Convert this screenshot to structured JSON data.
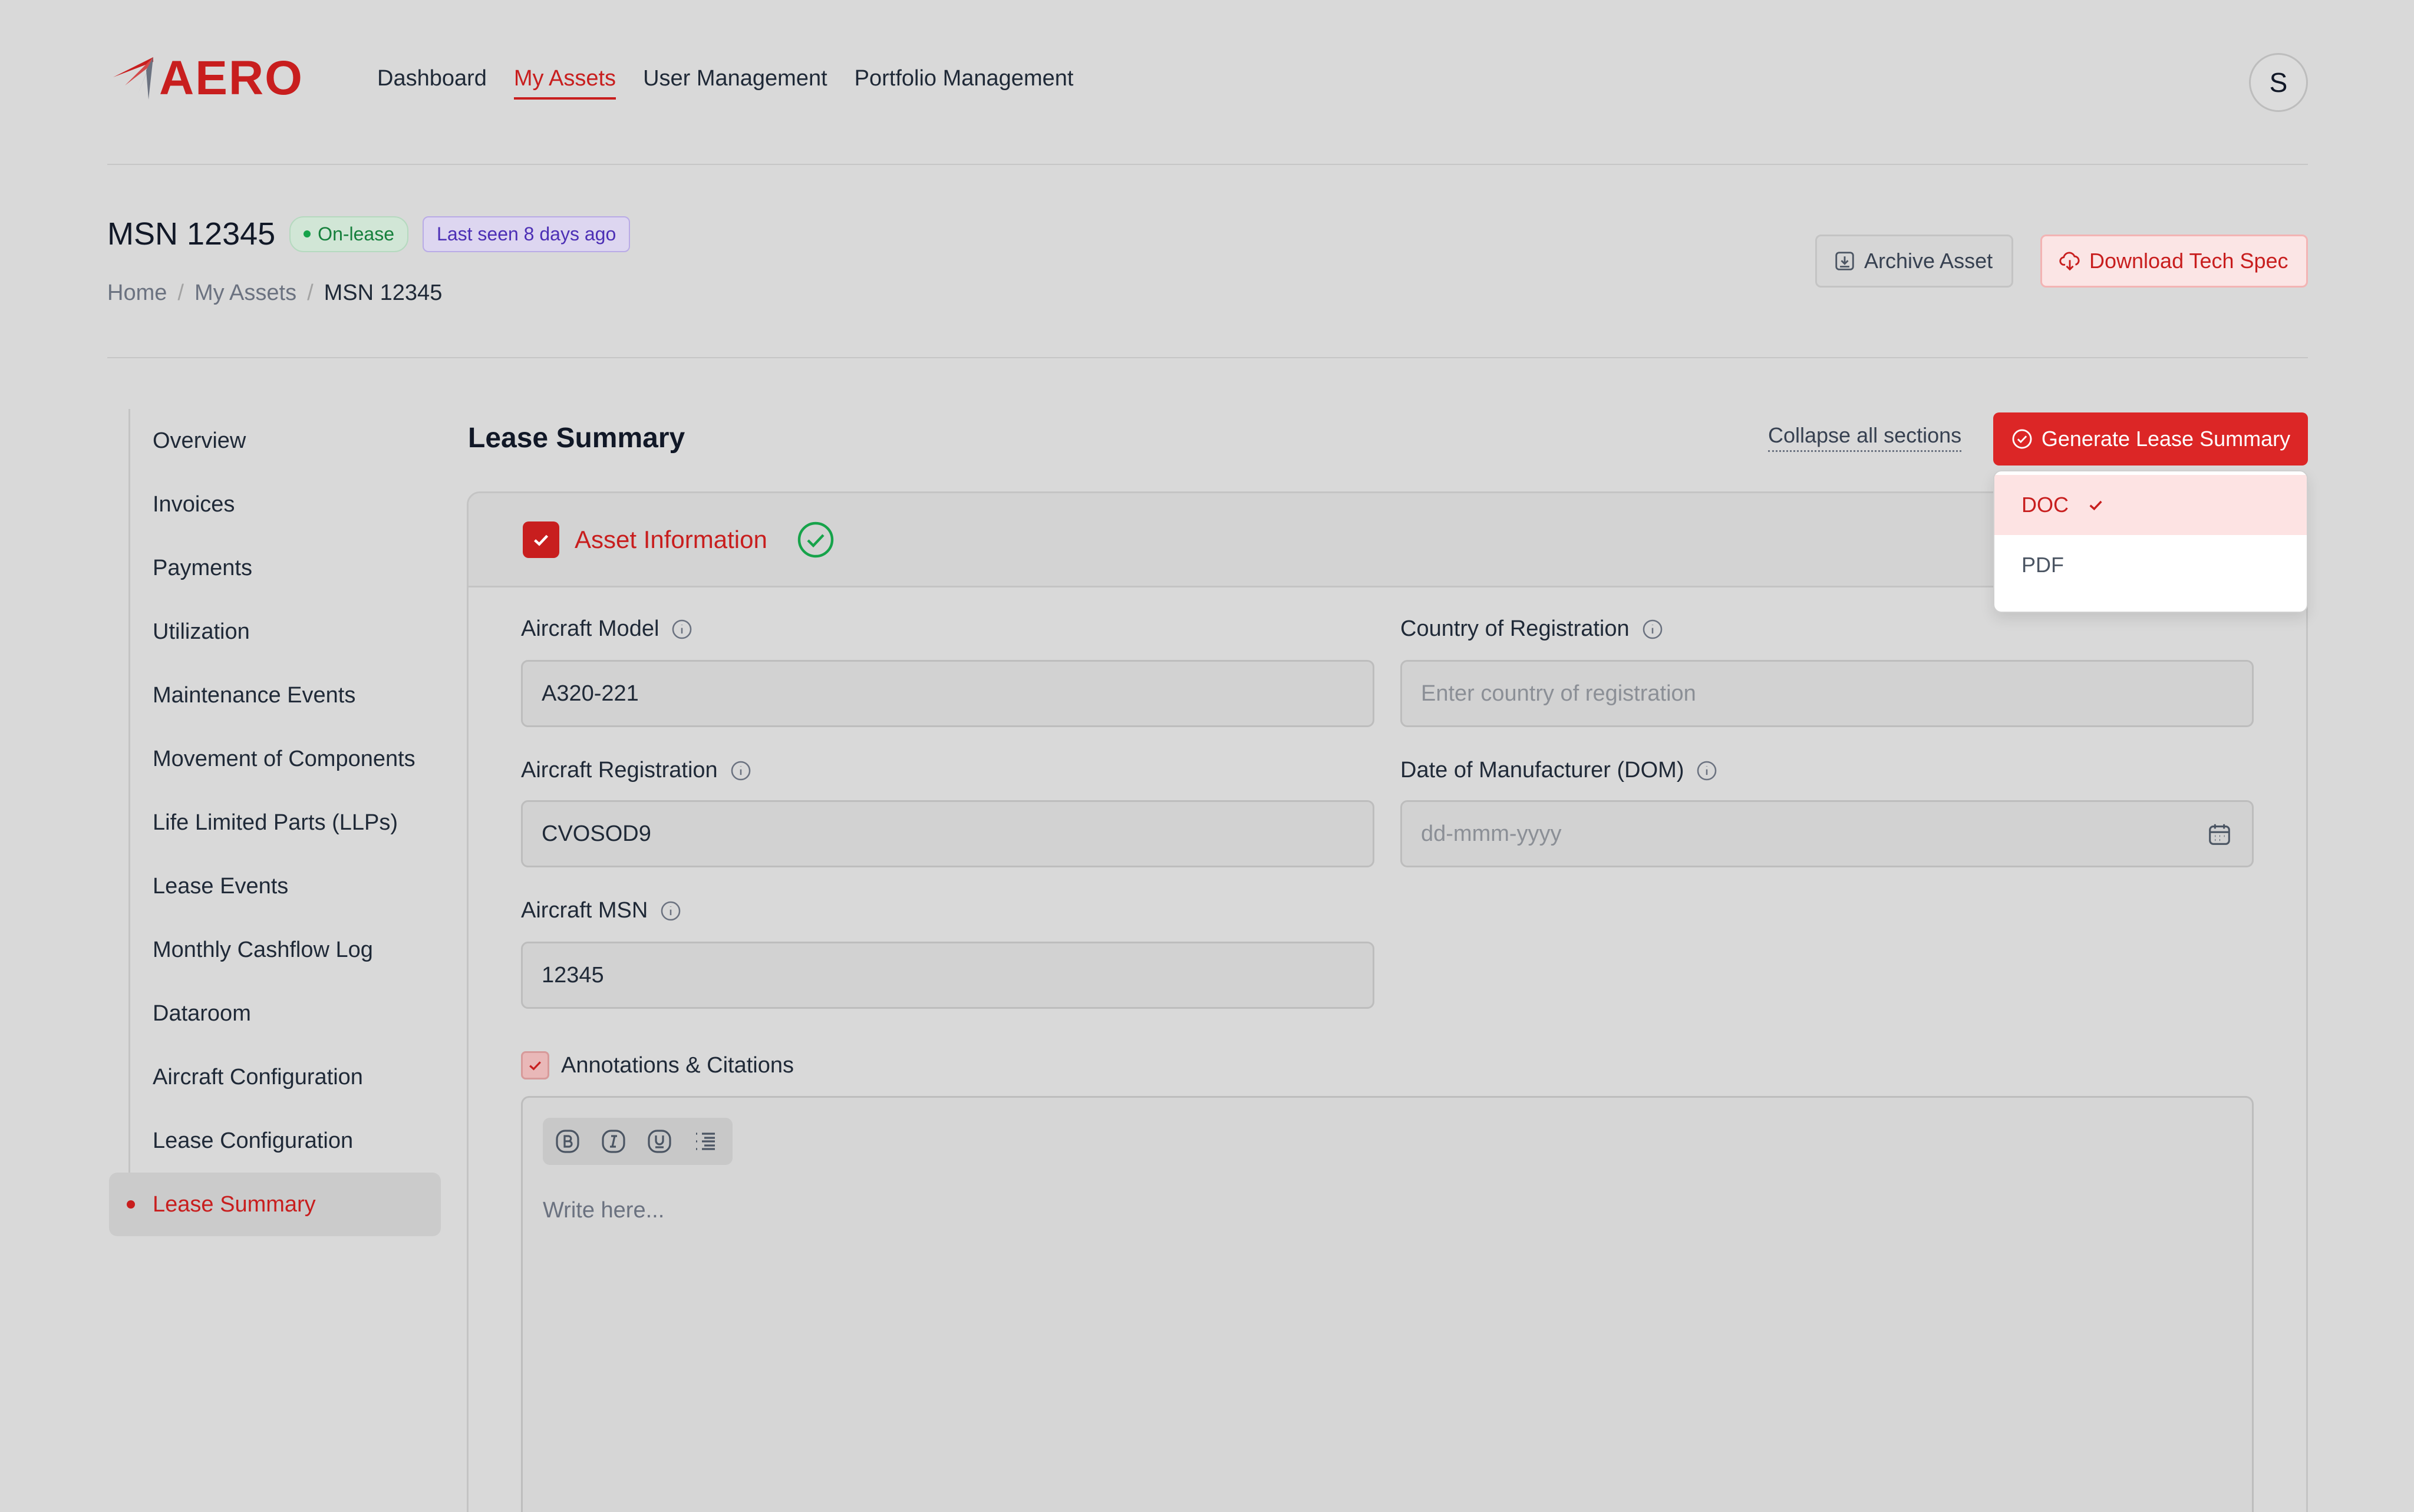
{
  "app": {
    "logo_text": "AERO",
    "brand_color": "#c81e1e",
    "nav": [
      "Dashboard",
      "My Assets",
      "User Management",
      "Portfolio Management"
    ],
    "active_nav": "My Assets",
    "avatar_initial": "S"
  },
  "asset": {
    "title": "MSN 12345",
    "status_badge": "On-lease",
    "last_seen_badge": "Last seen 8 days ago",
    "breadcrumb": [
      "Home",
      "My Assets",
      "MSN 12345"
    ],
    "archive_label": "Archive Asset",
    "download_label": "Download Tech Spec"
  },
  "sidebar": {
    "items": [
      "Overview",
      "Invoices",
      "Payments",
      "Utilization",
      "Maintenance Events",
      "Movement of Components",
      "Life Limited Parts (LLPs)",
      "Lease Events",
      "Monthly Cashflow Log",
      "Dataroom",
      "Aircraft Configuration",
      "Lease Configuration",
      "Lease Summary"
    ],
    "active": "Lease Summary"
  },
  "main": {
    "title": "Lease Summary",
    "collapse_label": "Collapse all sections",
    "generate_label": "Generate Lease Summary",
    "dropdown": {
      "options": [
        "DOC",
        "PDF"
      ],
      "selected": "DOC"
    },
    "section": {
      "title": "Asset Information",
      "fields": {
        "aircraft_model": {
          "label": "Aircraft Model",
          "value": "A320-221"
        },
        "country": {
          "label": "Country of Registration",
          "placeholder": "Enter country of registration"
        },
        "registration": {
          "label": "Aircraft Registration",
          "value": "CVOSOD9"
        },
        "dom": {
          "label": "Date of Manufacturer (DOM)",
          "placeholder": "dd-mmm-yyyy"
        },
        "msn": {
          "label": "Aircraft MSN",
          "value": "12345"
        }
      },
      "annotations_label": "Annotations & Citations",
      "editor_placeholder": "Write here..."
    }
  }
}
